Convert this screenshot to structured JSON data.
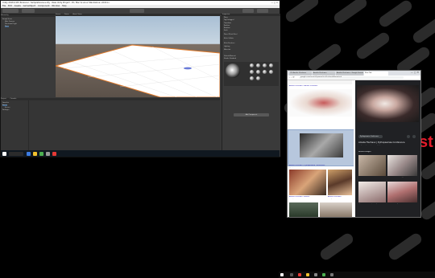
{
  "unity": {
    "title": "Unity 2018.4.0f1 Personal - SampleScene.unity - New Unity Project - PC, Mac & Linux Standalone <DX11>",
    "menu": [
      "File",
      "Edit",
      "Assets",
      "GameObject",
      "Component",
      "Window",
      "Help"
    ],
    "hierarchy_header": "Hierarchy",
    "hierarchy_items": [
      "SampleScene",
      "Main Camera",
      "Directional Light",
      "Plane"
    ],
    "scene_tabs": [
      "Scene",
      "Game",
      "Asset Store"
    ],
    "inspector_header": "Inspector",
    "inspector_rows": [
      "Plane",
      "Tag Untagged",
      "Transform",
      "Position",
      "Rotation",
      "Scale",
      "Plane (Mesh Filter)",
      "Mesh Collider",
      "Mesh Renderer",
      "Lighting",
      "Materials",
      "Default-Material",
      "Shader Standard",
      "Add Component"
    ],
    "project_header": "Project",
    "project_items": [
      "Favorites",
      "Assets",
      "Scenes",
      "Packages"
    ],
    "console_header": "Console"
  },
  "chrome": {
    "tabs": [
      "(1) Amélie Fléchaux",
      "Amélie Fléchaux",
      "Amélie Fléchaux - Google Search",
      "New Tab"
    ],
    "url": "google.com/search?q=amelie+flechaux&tbm=isch",
    "left_items": [
      {
        "title": "Amélie Fléchaux - Amélie Fléchaux",
        "sub": "amelieflechaux.com"
      },
      {
        "title": "Amélie Fléchaux | Pythopéaméa Conférence",
        "sub": "pythopeamea.com"
      },
      {
        "title": "Amélie Fléchaux - Artiste",
        "sub": "artmajeur.com"
      },
      {
        "title": "Amélie Fléchaux",
        "sub": "instagram.com"
      }
    ],
    "right_panel": {
      "source": "Pythopéaméa Conférence",
      "title": "Amélie Fléchaux | Pythopéaméa Conférence",
      "note": "Images may be subject to copyright. Learn More",
      "related_header": "Related images",
      "see_more": "See more",
      "related": [
        "Amélie Fléchaux - Photo - La vie...",
        "Amélie Fléchaux: Ceeqq Belo...",
        "I.J. Amélie Fléchaux | Artmajeur",
        "Artist of the day: Amélie Fléch..."
      ]
    }
  },
  "wallpaper_text": "st",
  "colors": {
    "wall_accent": "#e21b2a",
    "unity_bg": "#383838",
    "chrome_dark": "#202124"
  }
}
